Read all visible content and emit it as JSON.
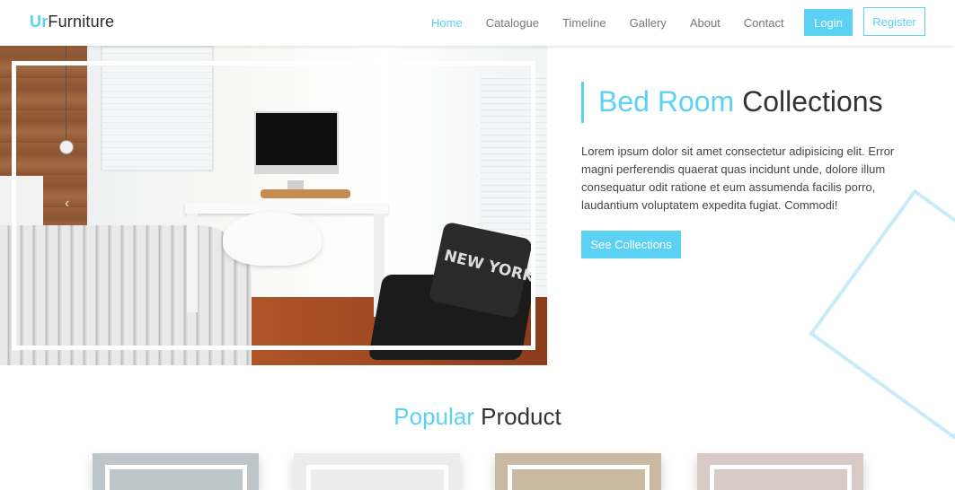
{
  "brand": {
    "accent": "Ur",
    "rest": "Furniture"
  },
  "nav": {
    "items": [
      {
        "label": "Home",
        "active": true
      },
      {
        "label": "Catalogue",
        "active": false
      },
      {
        "label": "Timeline",
        "active": false
      },
      {
        "label": "Gallery",
        "active": false
      },
      {
        "label": "About",
        "active": false
      },
      {
        "label": "Contact",
        "active": false
      }
    ],
    "login_label": "Login",
    "register_label": "Register"
  },
  "hero": {
    "title_accent": "Bed Room",
    "title_rest": "Collections",
    "description": "Lorem ipsum dolor sit amet consectetur adipisicing elit. Error magni perferendis quaerat quas incidunt unde, dolore illum consequatur odit ratione et eum assumenda facilis porro, laudantium voluptatem expedita fugiat. Commodi!",
    "button_label": "See Collections",
    "image_pillow_text": "NEW YORK"
  },
  "popular": {
    "title_accent": "Popular",
    "title_rest": "Product",
    "cards": [
      {
        "bg": "#bcc6ca"
      },
      {
        "bg": "#ececec"
      },
      {
        "bg": "#c9b9a3"
      },
      {
        "bg": "#d8cbc6"
      }
    ]
  },
  "colors": {
    "accent": "#5bd2f3",
    "text": "#333333",
    "nav_text": "#777777"
  }
}
